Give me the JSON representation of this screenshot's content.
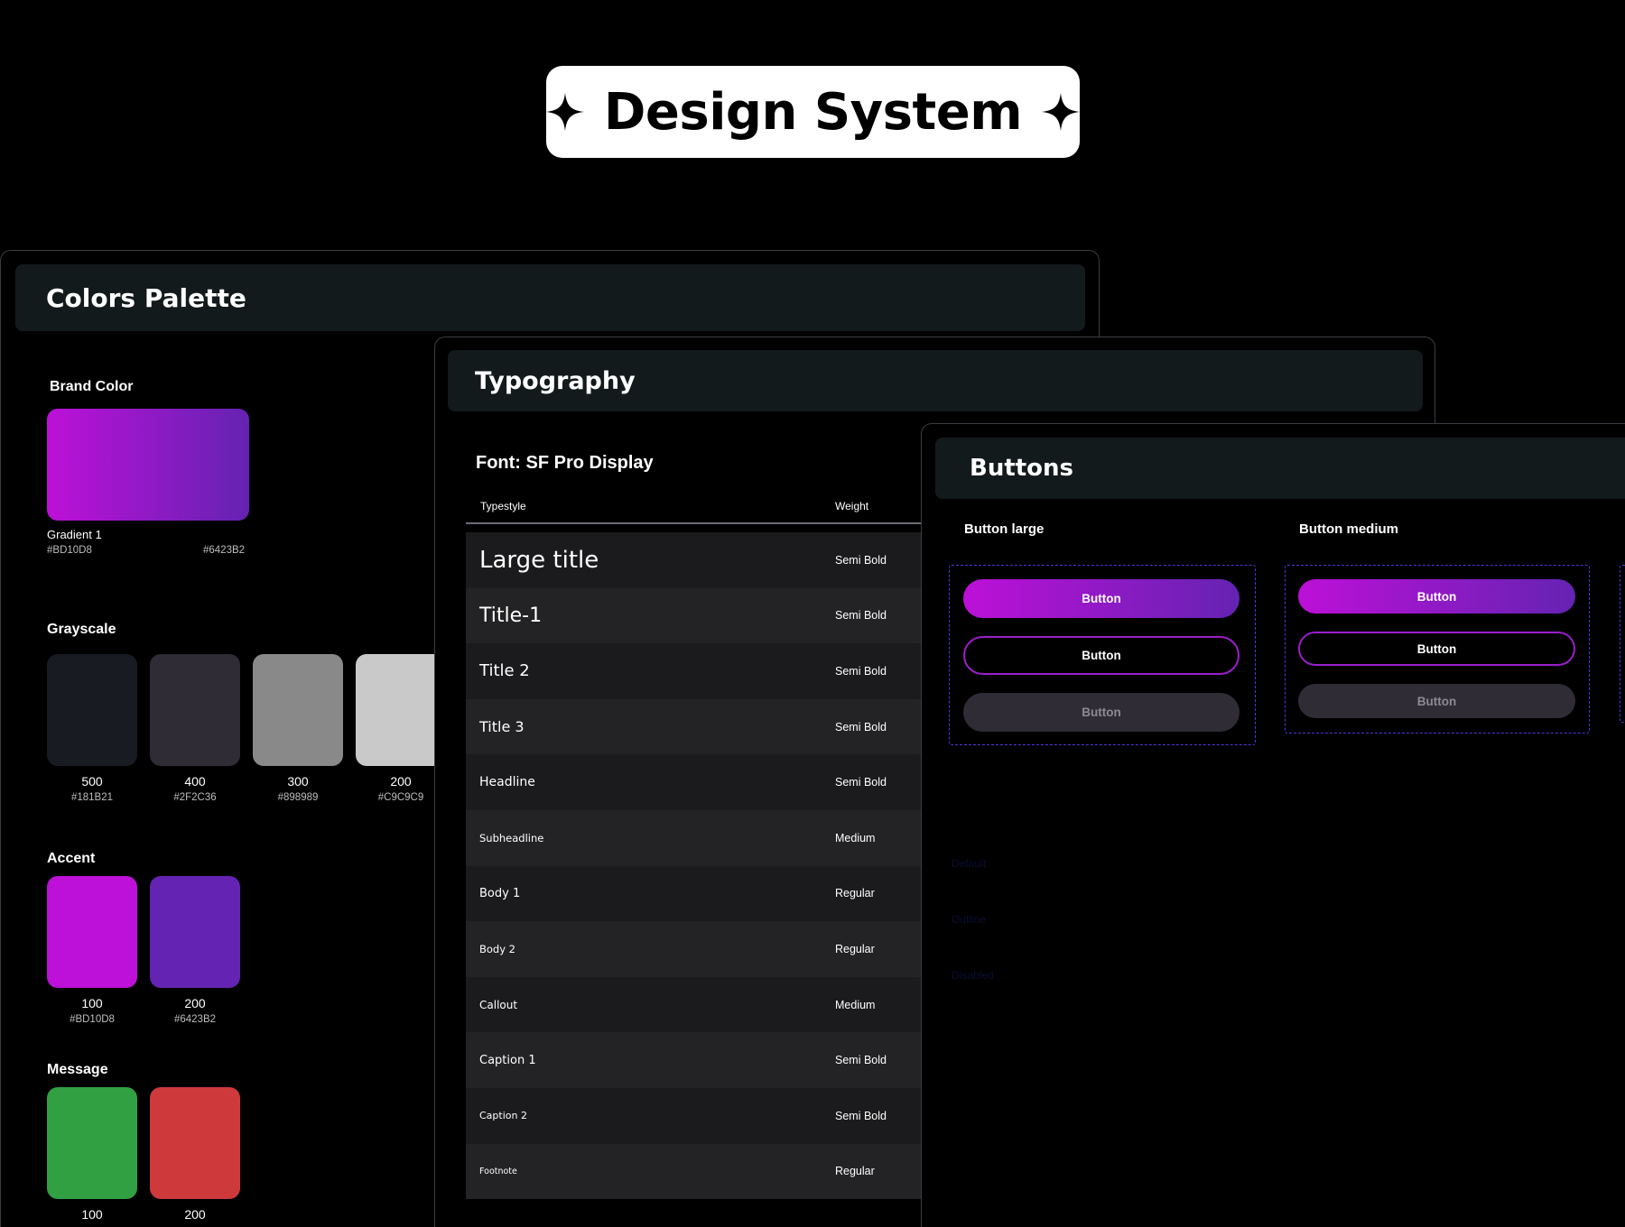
{
  "hero": {
    "title": "Design System"
  },
  "colors": {
    "title": "Colors Palette",
    "brand": {
      "label": "Brand Color",
      "gradient_name": "Gradient 1",
      "hex_start": "#BD10D8",
      "hex_end": "#6423B2"
    },
    "grayscale": {
      "label": "Grayscale",
      "swatches": [
        {
          "name": "500",
          "hex": "#181B21"
        },
        {
          "name": "400",
          "hex": "#2F2C36"
        },
        {
          "name": "300",
          "hex": "#898989"
        },
        {
          "name": "200",
          "hex": "#C9C9C9"
        }
      ]
    },
    "accent": {
      "label": "Accent",
      "swatches": [
        {
          "name": "100",
          "hex": "#BD10D8"
        },
        {
          "name": "200",
          "hex": "#6423B2"
        }
      ]
    },
    "message": {
      "label": "Message",
      "swatches": [
        {
          "name": "100",
          "color": "#31A043"
        },
        {
          "name": "200",
          "color": "#CE3A3C"
        }
      ]
    }
  },
  "typography": {
    "title": "Typography",
    "font_label": "Font: SF Pro Display",
    "col_typestyle": "Typestyle",
    "col_weight": "Weight",
    "rows": [
      {
        "style": "Large title",
        "weight": "Semi Bold"
      },
      {
        "style": "Title-1",
        "weight": "Semi Bold"
      },
      {
        "style": "Title 2",
        "weight": "Semi Bold"
      },
      {
        "style": "Title 3",
        "weight": "Semi Bold"
      },
      {
        "style": "Headline",
        "weight": "Semi Bold"
      },
      {
        "style": "Subheadline",
        "weight": "Medium"
      },
      {
        "style": "Body 1",
        "weight": "Regular"
      },
      {
        "style": "Body 2",
        "weight": "Regular"
      },
      {
        "style": "Callout",
        "weight": "Medium"
      },
      {
        "style": "Caption 1",
        "weight": "Semi Bold"
      },
      {
        "style": "Caption 2",
        "weight": "Semi Bold"
      },
      {
        "style": "Footnote",
        "weight": "Regular"
      }
    ]
  },
  "buttons": {
    "title": "Buttons",
    "large_label": "Button large",
    "medium_label": "Button medium",
    "button_text": "Button",
    "states": [
      "Default",
      "Outline",
      "Disabled"
    ]
  }
}
